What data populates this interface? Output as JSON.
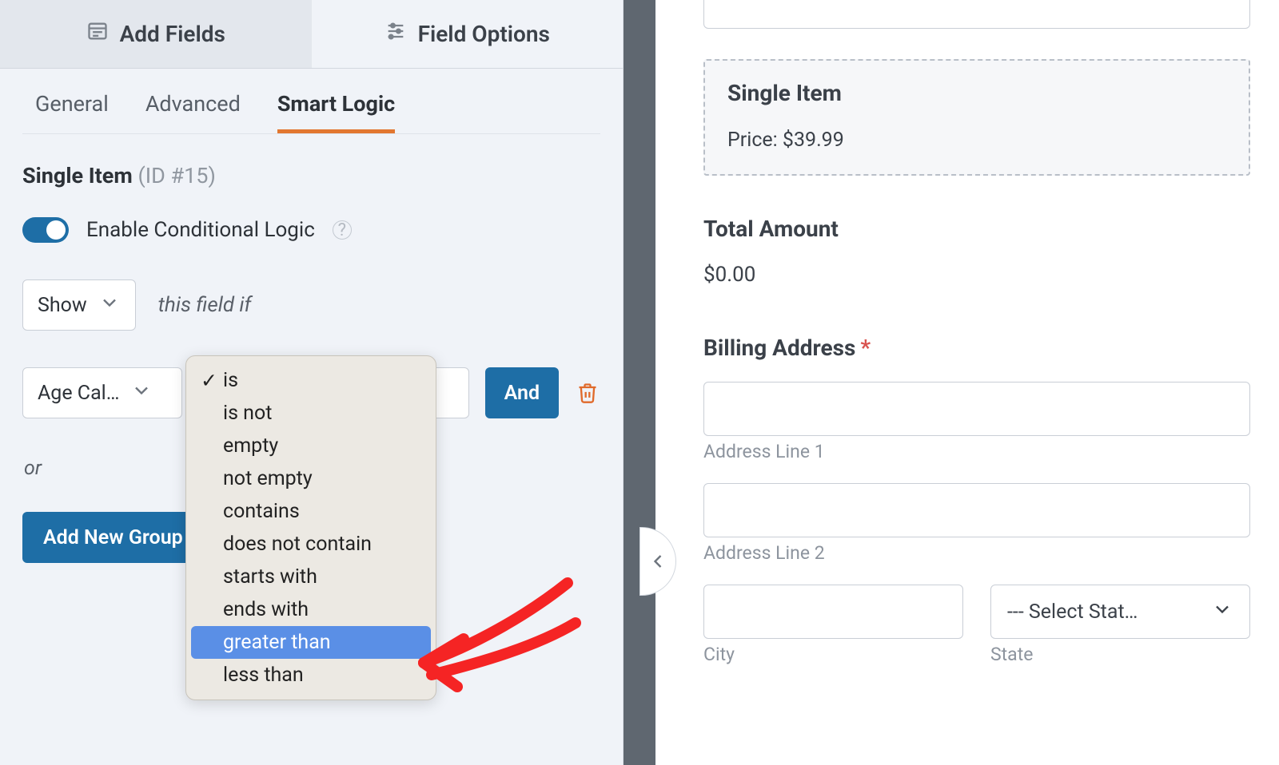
{
  "top_tabs": {
    "add_fields": "Add Fields",
    "field_options": "Field Options"
  },
  "sub_tabs": {
    "general": "General",
    "advanced": "Advanced",
    "smart_logic": "Smart Logic"
  },
  "field_header": {
    "name": "Single Item",
    "id_text": "(ID #15)"
  },
  "enable_row": {
    "label": "Enable Conditional Logic"
  },
  "cond": {
    "action": "Show",
    "suffix": "this field if"
  },
  "rule": {
    "field": "Age Cal…",
    "and": "And"
  },
  "or_label": "or",
  "add_group": "Add New Group",
  "operator_options": [
    "is",
    "is not",
    "empty",
    "not empty",
    "contains",
    "does not contain",
    "starts with",
    "ends with",
    "greater than",
    "less than"
  ],
  "operator_selected_index": 0,
  "operator_highlight_index": 8,
  "preview": {
    "single_item": {
      "title": "Single Item",
      "price": "Price: $39.99"
    },
    "total": {
      "label": "Total Amount",
      "value": "$0.00"
    },
    "billing": {
      "label": "Billing Address",
      "line1": "Address Line 1",
      "line2": "Address Line 2",
      "city": "City",
      "state": "State",
      "state_placeholder": "--- Select Stat…"
    }
  }
}
